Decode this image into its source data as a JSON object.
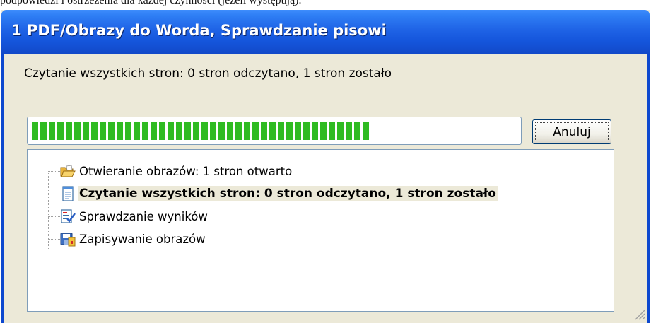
{
  "caption": "podpowiedzi i ostrzeżenia dla każdej czynności (jeżeli występują).",
  "window": {
    "title": "1 PDF/Obrazy do Worda, Sprawdzanie pisowi"
  },
  "status_text": "Czytanie wszystkich stron: 0 stron odczytano, 1 stron zostało",
  "progress_percent": 70,
  "cancel_label": "Anuluj",
  "steps": [
    {
      "label": "Otwieranie obrazów: 1 stron otwarto",
      "icon": "folder-open-icon",
      "active": false
    },
    {
      "label": "Czytanie wszystkich stron: 0 stron odczytano, 1 stron zostało",
      "icon": "document-icon",
      "active": true
    },
    {
      "label": "Sprawdzanie wyników",
      "icon": "spellcheck-icon",
      "active": false
    },
    {
      "label": "Zapisywanie obrazów",
      "icon": "save-icon",
      "active": false
    }
  ],
  "colors": {
    "titlebar": "#1f63e6",
    "progress": "#2fbb22",
    "dialog_bg": "#ece9d8"
  }
}
